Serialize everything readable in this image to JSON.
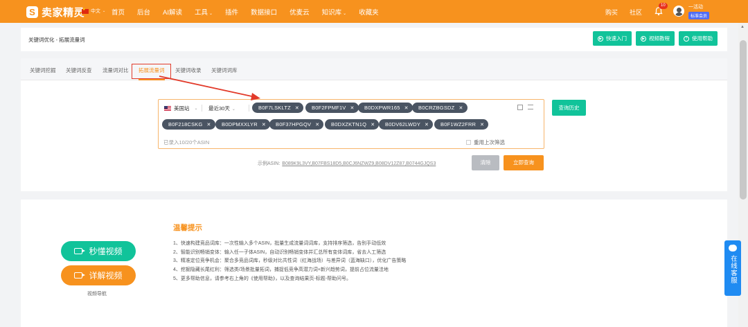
{
  "nav": {
    "logo_mark": "S",
    "logo_text": "卖家精灵",
    "lang": "中文",
    "items": [
      {
        "label": "首页",
        "caret": ""
      },
      {
        "label": "后台",
        "caret": ""
      },
      {
        "label": "AI解读",
        "caret": ""
      },
      {
        "label": "工具",
        "caret": "⌄"
      },
      {
        "label": "插件",
        "caret": ""
      },
      {
        "label": "数据接口",
        "caret": ""
      },
      {
        "label": "优麦云",
        "caret": ""
      },
      {
        "label": "知识库",
        "caret": "⌄"
      },
      {
        "label": "收藏夹",
        "caret": ""
      }
    ],
    "buy": "购买",
    "community": "社区",
    "notif_count": "10",
    "username": "一活动",
    "vip": "标准会员",
    "brand_color": "#f7921e"
  },
  "header": {
    "breadcrumb": "关键词优化 - 拓展流量词",
    "buttons": [
      {
        "label": "快速入门",
        "icon": "play-icon"
      },
      {
        "label": "视频教程",
        "icon": "play-icon"
      },
      {
        "label": "使用帮助",
        "icon": "help-icon"
      }
    ]
  },
  "tabs": [
    {
      "label": "关键词挖掘",
      "active": false
    },
    {
      "label": "关键词反查",
      "active": false
    },
    {
      "label": "流量词对比",
      "active": false
    },
    {
      "label": "拓展流量词",
      "active": true
    },
    {
      "label": "关键词收录",
      "active": false
    },
    {
      "label": "关键词词库",
      "active": false
    }
  ],
  "search": {
    "marketplace": "美国站",
    "range": "最近30天",
    "asins": [
      "B0F7LSKLTZ",
      "B0F2FPMF1V",
      "B0DXPWR165",
      "B0CRZBGSDZ",
      "B0F218CSKG",
      "B0DPMXXLYR",
      "B0F37HPGQV",
      "B0DXZKTN1Q",
      "B0DV62LWDY",
      "B0F1WZ2FRR"
    ],
    "count_text": "已录入10/20个ASIN",
    "reuse_label": "重用上次筛选",
    "history_btn": "查询历史",
    "example_label": "示例ASIN:",
    "example_asins": "B089K9L3VY,B07FBS18D5,B0CJ6NZWZ9,B08DV12Z87,B0744GJQS3",
    "clear_btn": "清除",
    "query_btn": "立即查询"
  },
  "bottom": {
    "video1": "秒懂视频",
    "video2": "详解视频",
    "video_nav": "视频导航",
    "tips_title": "温馨提示",
    "tips": [
      "1、快速构建竞品词库：一次性输入多个ASIN，批量生成流量词词库，支持排序筛选，告别手动低效",
      "2、智能识别畅销变体：输入任一子体ASIN，自动识别畅销变体并汇总所有变体词库，省去人工筛选",
      "3、精准定位竞争机会：聚合多竞品词库，秒级对比共性词（红海战场）与差异词（蓝海缺口），优化广告策略",
      "4、挖掘隐藏长尾红利：筛选类/场景批量拓词，捕捉低竞争高潜力词+新兴趋势词，提前占位流量洼地",
      "5、更多帮助信息，请参考右上角的《使用帮助》，以及查询结果页-标题-帮助问号。"
    ]
  },
  "service": {
    "label": "在线客服"
  }
}
